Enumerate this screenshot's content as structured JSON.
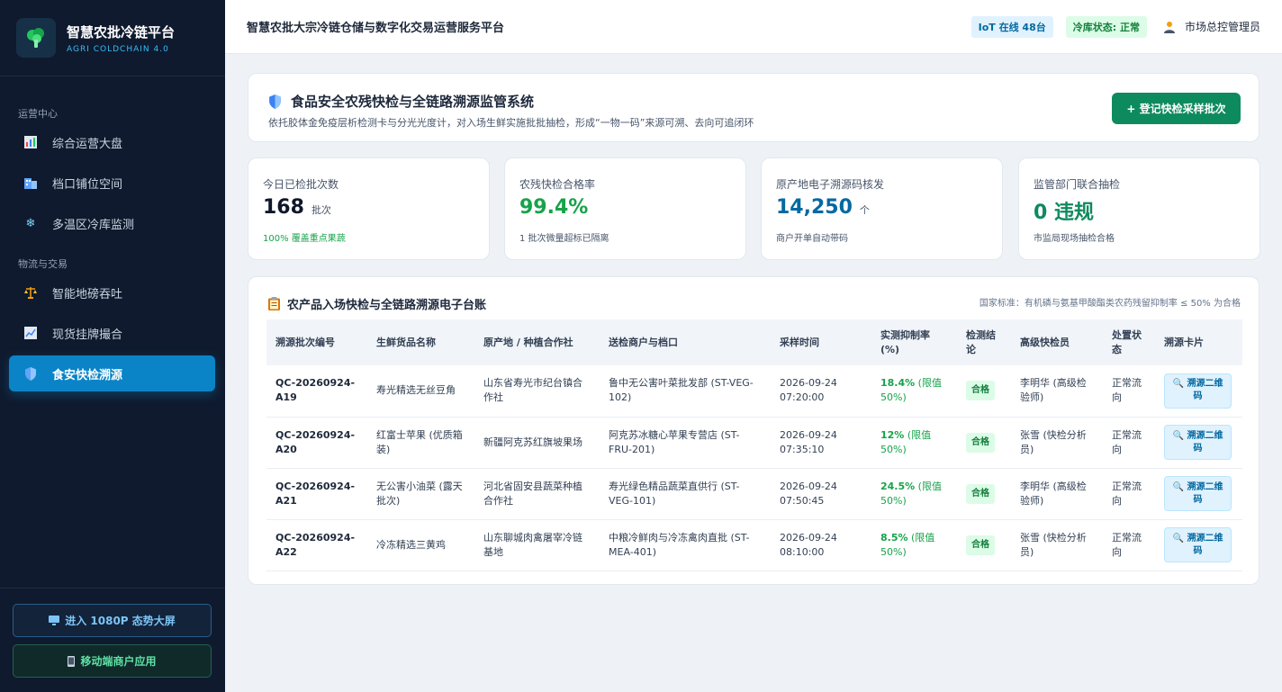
{
  "brand": {
    "title": "智慧农批冷链平台",
    "subtitle": "AGRI COLDCHAIN 4.0"
  },
  "sidebar": {
    "section_ops": "运营中心",
    "section_logistics": "物流与交易",
    "items": [
      {
        "label": "综合运营大盘",
        "icon": "bar-chart-icon"
      },
      {
        "label": "档口铺位空间",
        "icon": "building-icon"
      },
      {
        "label": "多温区冷库监测",
        "icon": "snowflake-icon"
      },
      {
        "label": "智能地磅吞吐",
        "icon": "scale-icon"
      },
      {
        "label": "现货挂牌撮合",
        "icon": "trend-chart-icon"
      },
      {
        "label": "食安快检溯源",
        "icon": "shield-icon"
      }
    ],
    "btn_screen": "进入 1080P 态势大屏",
    "btn_mobile": "移动端商户应用"
  },
  "header": {
    "title": "智慧农批大宗冷链仓储与数字化交易运营服务平台",
    "iot": "IoT 在线 48台",
    "cold_status": "冷库状态: 正常",
    "user": "市场总控管理员"
  },
  "hero": {
    "title": "食品安全农残快检与全链路溯源监管系统",
    "desc": "依托胶体金免疫层析检测卡与分光光度计，对入场生鲜实施批批抽检，形成“一物一码”来源可溯、去向可追闭环",
    "button": "+ 登记快检采样批次"
  },
  "stats": [
    {
      "label": "今日已检批次数",
      "value": "168",
      "unit": "批次",
      "note": "100% 覆盖重点果蔬"
    },
    {
      "label": "农残快检合格率",
      "value": "99.4%",
      "unit": "",
      "note": "1 批次微量超标已隔离"
    },
    {
      "label": "原产地电子溯源码核发",
      "value": "14,250",
      "unit": "个",
      "note": "商户开单自动带码"
    },
    {
      "label": "监管部门联合抽检",
      "value": "0 违规",
      "unit": "",
      "note": "市监局现场抽检合格"
    }
  ],
  "ledger": {
    "title": "农产品入场快检与全链路溯源电子台账",
    "standard": "国家标准：有机磷与氨基甲酸酯类农药残留抑制率 ≤ 50% 为合格",
    "columns": [
      "溯源批次编号",
      "生鲜货品名称",
      "原产地 / 种植合作社",
      "送检商户与档口",
      "采样时间",
      "实测抑制率 (%)",
      "检测结论",
      "高级快检员",
      "处置状态",
      "溯源卡片"
    ],
    "rows": [
      {
        "id": "QC-20260924-A19",
        "product": "寿光精选无丝豆角",
        "origin": "山东省寿光市纪台镇合作社",
        "merchant": "鲁中无公害叶菜批发部 (ST-VEG-102)",
        "time": "2026-09-24 07:20:00",
        "rate": "18.4%",
        "limit": "(限值 50%)",
        "result": "合格",
        "inspector": "李明华 (高级检验师)",
        "status": "正常流向",
        "action": "🔍 溯源二维码"
      },
      {
        "id": "QC-20260924-A20",
        "product": "红富士苹果 (优质箱装)",
        "origin": "新疆阿克苏红旗坡果场",
        "merchant": "阿克苏冰糖心苹果专营店 (ST-FRU-201)",
        "time": "2026-09-24 07:35:10",
        "rate": "12%",
        "limit": "(限值 50%)",
        "result": "合格",
        "inspector": "张雪 (快检分析员)",
        "status": "正常流向",
        "action": "🔍 溯源二维码"
      },
      {
        "id": "QC-20260924-A21",
        "product": "无公害小油菜 (露天批次)",
        "origin": "河北省固安县蔬菜种植合作社",
        "merchant": "寿光绿色精品蔬菜直供行 (ST-VEG-101)",
        "time": "2026-09-24 07:50:45",
        "rate": "24.5%",
        "limit": "(限值 50%)",
        "result": "合格",
        "inspector": "李明华 (高级检验师)",
        "status": "正常流向",
        "action": "🔍 溯源二维码"
      },
      {
        "id": "QC-20260924-A22",
        "product": "冷冻精选三黄鸡",
        "origin": "山东聊城肉禽屠宰冷链基地",
        "merchant": "中粮冷鲜肉与冷冻禽肉直批 (ST-MEA-401)",
        "time": "2026-09-24 08:10:00",
        "rate": "8.5%",
        "limit": "(限值 50%)",
        "result": "合格",
        "inspector": "张雪 (快检分析员)",
        "status": "正常流向",
        "action": "🔍 溯源二维码"
      }
    ]
  },
  "colors": {
    "sidebar_bg": "#0f1a2e",
    "accent": "#0a84c6",
    "green": "#0e8a5f",
    "pass": "#16a34a",
    "blue_value": "#0369a1"
  }
}
